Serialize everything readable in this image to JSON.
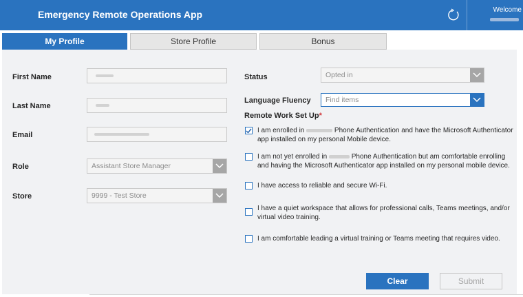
{
  "header": {
    "title": "Emergency Remote Operations App",
    "welcome": "Welcome",
    "bg_color": "#2a73bf"
  },
  "tabs": [
    {
      "label": "My Profile",
      "active": true
    },
    {
      "label": "Store Profile",
      "active": false
    },
    {
      "label": "Bonus",
      "active": false
    }
  ],
  "profile": {
    "first_name_label": "First Name",
    "last_name_label": "Last Name",
    "email_label": "Email",
    "role_label": "Role",
    "role_value": "Assistant Store Manager",
    "store_label": "Store",
    "store_value": "9999 - Test Store"
  },
  "status": {
    "label": "Status",
    "value": "Opted in"
  },
  "language": {
    "label": "Language Fluency",
    "placeholder": "Find items"
  },
  "remote_setup": {
    "label": "Remote Work Set Up",
    "required_mark": "*",
    "options": [
      {
        "text_before": "I am enrolled in ",
        "text_after": " Phone Authentication and have the Microsoft Authenticator app installed on my personal Mobile device.",
        "checked": true
      },
      {
        "text_before": "I am not yet enrolled in ",
        "text_after": " Phone Authentication but am comfortable enrolling and having the Microsoft Authenticator app installed on my personal mobile device.",
        "checked": false
      },
      {
        "text": "I have access to reliable and secure Wi-Fi.",
        "checked": false
      },
      {
        "text": "I have a quiet workspace that allows for professional calls, Teams meetings, and/or virtual video training.",
        "checked": false
      },
      {
        "text": "I am comfortable leading a virtual training or Teams meeting that requires video.",
        "checked": false
      }
    ]
  },
  "buttons": {
    "clear": "Clear",
    "submit": "Submit"
  },
  "icons": {
    "refresh": "refresh-icon",
    "dropdown": "chevron-down-icon",
    "check": "checkmark-icon"
  }
}
